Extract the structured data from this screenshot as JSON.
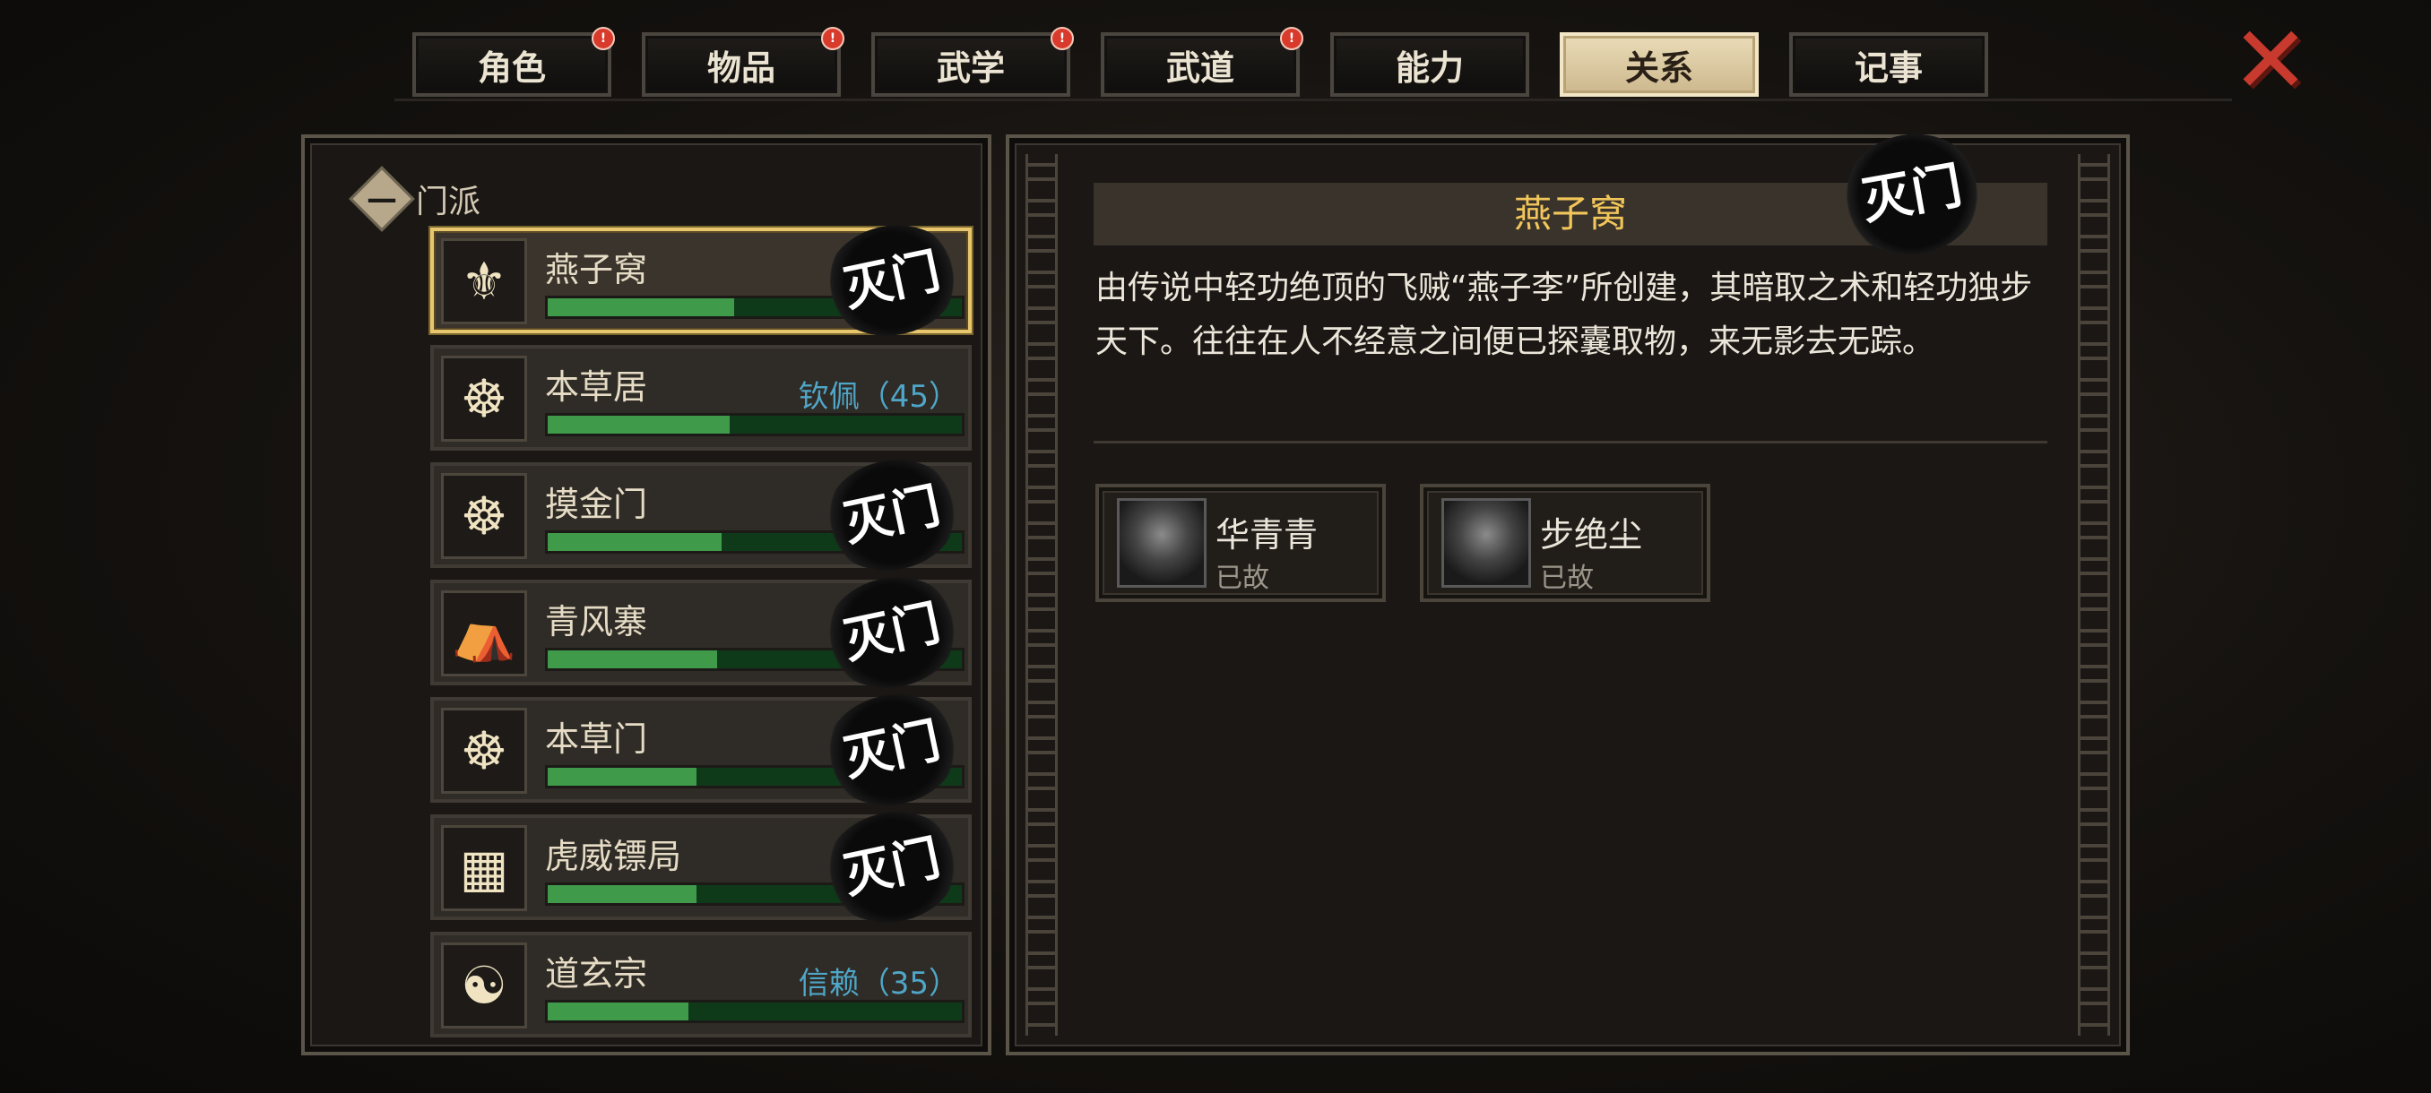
{
  "tabs": [
    {
      "label": "角色",
      "badge": "!"
    },
    {
      "label": "物品",
      "badge": "!"
    },
    {
      "label": "武学",
      "badge": "!"
    },
    {
      "label": "武道",
      "badge": "!"
    },
    {
      "label": "能力",
      "badge": ""
    },
    {
      "label": "关系",
      "badge": "",
      "active": true
    },
    {
      "label": "记事",
      "badge": ""
    }
  ],
  "close_icon": "✕",
  "sidebar": {
    "section_label": "门派",
    "collapse_symbol": "—"
  },
  "factions": [
    {
      "name": "燕子窝",
      "progress": 0.45,
      "relation": "",
      "stamp": "灭门",
      "emblem": "bird-crest-icon",
      "selected": true
    },
    {
      "name": "本草居",
      "progress": 0.44,
      "relation": "钦佩（45）",
      "stamp": "",
      "emblem": "herb-crest-icon"
    },
    {
      "name": "摸金门",
      "progress": 0.42,
      "relation": "",
      "stamp": "灭门",
      "emblem": "herb-crest-icon"
    },
    {
      "name": "青风寨",
      "progress": 0.41,
      "relation": "",
      "stamp": "灭门",
      "emblem": "tent-crest-icon"
    },
    {
      "name": "本草门",
      "progress": 0.36,
      "relation": "",
      "stamp": "灭门",
      "emblem": "herb-crest-icon"
    },
    {
      "name": "虎威镖局",
      "progress": 0.36,
      "relation": "",
      "stamp": "灭门",
      "emblem": "tiger-crest-icon"
    },
    {
      "name": "道玄宗",
      "progress": 0.34,
      "relation": "信赖（35）",
      "stamp": "",
      "emblem": "taiji-crest-icon"
    }
  ],
  "detail": {
    "title": "燕子窝",
    "stamp": "灭门",
    "description": "由传说中轻功绝顶的飞贼“燕子李”所创建，其暗取之术和轻功独步天下。往往在人不经意之间便已探囊取物，来无影去无踪。",
    "members": [
      {
        "name": "华青青",
        "status": "已故"
      },
      {
        "name": "步绝尘",
        "status": "已故"
      }
    ]
  },
  "emblem_glyphs": {
    "bird-crest-icon": "⚜",
    "herb-crest-icon": "☸",
    "tent-crest-icon": "⛺",
    "tiger-crest-icon": "▦",
    "taiji-crest-icon": "☯"
  }
}
